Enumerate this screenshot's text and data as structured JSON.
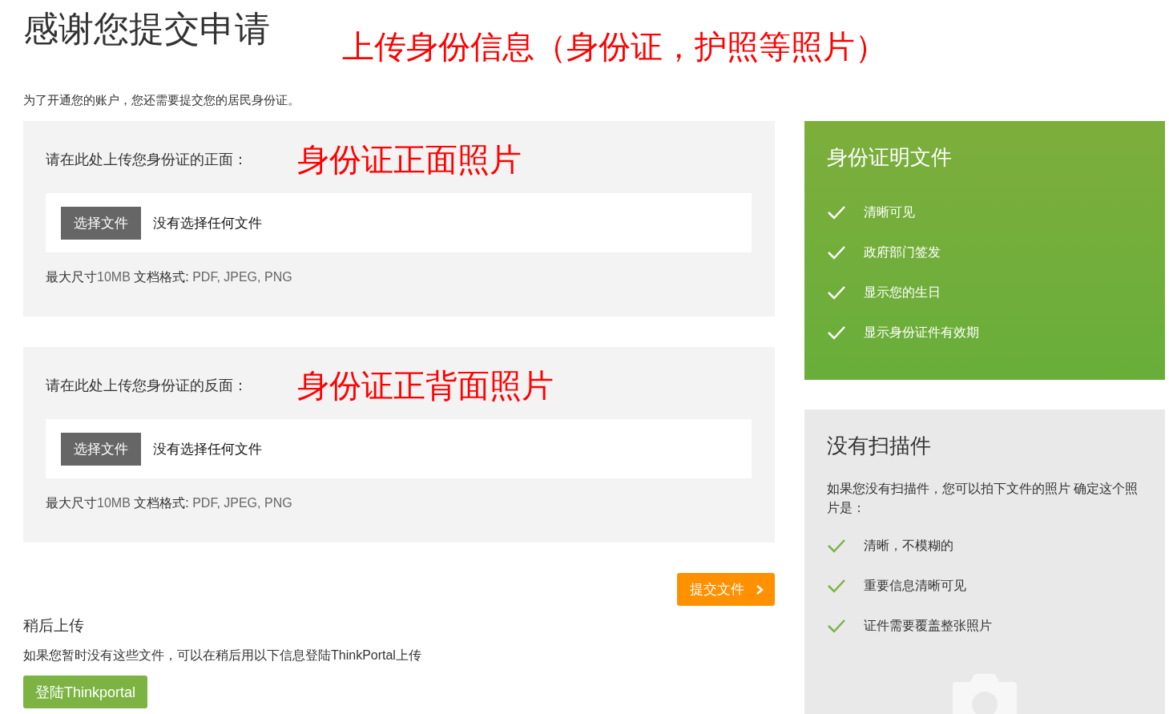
{
  "page": {
    "title": "感谢您提交申请",
    "annotation": "上传身份信息（身份证，护照等照片）",
    "subtitle": "为了开通您的账户，您还需要提交您的居民身份证。"
  },
  "upload_cards": [
    {
      "label": "请在此处上传您身份证的正面：",
      "annotation": "身份证正面照片",
      "button": "选择文件",
      "file_status": "没有选择任何文件",
      "hint_prefix": "最大尺寸",
      "hint_size": "10MB",
      "hint_formats_label": "文档格式:",
      "hint_formats": "PDF, JPEG, PNG"
    },
    {
      "label": "请在此处上传您身份证的反面：",
      "annotation": "身份证正背面照片",
      "button": "选择文件",
      "file_status": "没有选择任何文件",
      "hint_prefix": "最大尺寸",
      "hint_size": "10MB",
      "hint_formats_label": "文档格式:",
      "hint_formats": "PDF, JPEG, PNG"
    }
  ],
  "submit_button": "提交文件",
  "later": {
    "title": "稍后上传",
    "text": "如果您暂时没有这些文件，可以在稍后用以下信息登陆ThinkPortal上传",
    "button": "登陆Thinkportal"
  },
  "id_panel": {
    "title": "身份证明文件",
    "items": [
      "清晰可见",
      "政府部门签发",
      "显示您的生日",
      "显示身份证件有效期"
    ]
  },
  "scan_panel": {
    "title": "没有扫描件",
    "text": "如果您没有扫描件，您可以拍下文件的照片 确定这个照片是：",
    "items": [
      "清晰，不模糊的",
      "重要信息清晰可见",
      "证件需要覆盖整张照片"
    ]
  }
}
